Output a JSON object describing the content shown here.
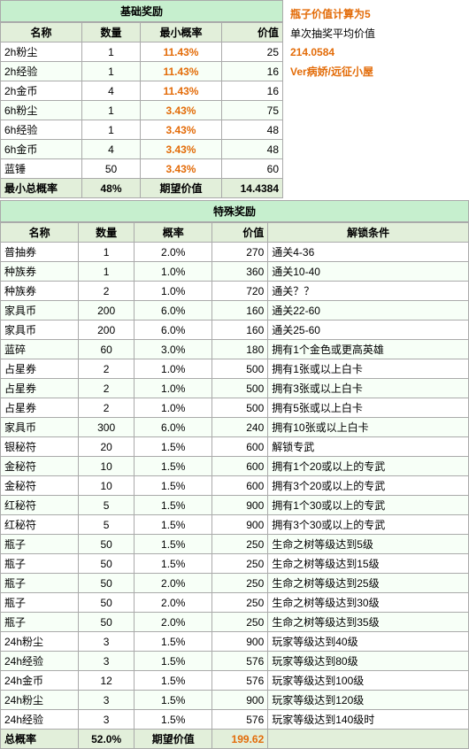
{
  "basic_section": {
    "header": "基础奖励",
    "columns": [
      "名称",
      "数量",
      "最小概率",
      "价值"
    ],
    "rows": [
      {
        "name": "2h粉尘",
        "count": "1",
        "prob": "11.43%",
        "value": "25"
      },
      {
        "name": "2h经验",
        "count": "1",
        "prob": "11.43%",
        "value": "16"
      },
      {
        "name": "2h金币",
        "count": "4",
        "prob": "11.43%",
        "value": "16"
      },
      {
        "name": "6h粉尘",
        "count": "1",
        "prob": "3.43%",
        "value": "75"
      },
      {
        "name": "6h经验",
        "count": "1",
        "prob": "3.43%",
        "value": "48"
      },
      {
        "name": "6h金币",
        "count": "4",
        "prob": "3.43%",
        "value": "48"
      },
      {
        "name": "蓝锤",
        "count": "50",
        "prob": "3.43%",
        "value": "60"
      }
    ],
    "footer": {
      "min_rate_label": "最小总概率",
      "min_rate_value": "48%",
      "expected_label": "期望价值",
      "expected_value": "14.4384"
    }
  },
  "side_info": {
    "line1": "瓶子价值计算为5",
    "line2": "单次抽奖平均价值",
    "line3": "214.0584",
    "line4": "Ver病娇/远征小屋"
  },
  "special_section": {
    "header": "特殊奖励",
    "columns": [
      "名称",
      "数量",
      "概率",
      "价值",
      "解锁条件"
    ],
    "rows": [
      {
        "name": "普抽券",
        "count": "1",
        "prob": "2.0%",
        "value": "270",
        "unlock": "通关4-36"
      },
      {
        "name": "种族券",
        "count": "1",
        "prob": "1.0%",
        "value": "360",
        "unlock": "通关10-40"
      },
      {
        "name": "种族券",
        "count": "2",
        "prob": "1.0%",
        "value": "720",
        "unlock": "通关？？"
      },
      {
        "name": "家具币",
        "count": "200",
        "prob": "6.0%",
        "value": "160",
        "unlock": "通关22-60"
      },
      {
        "name": "家具币",
        "count": "200",
        "prob": "6.0%",
        "value": "160",
        "unlock": "通关25-60"
      },
      {
        "name": "蓝碎",
        "count": "60",
        "prob": "3.0%",
        "value": "180",
        "unlock": "拥有1个金色或更高英雄"
      },
      {
        "name": "占星券",
        "count": "2",
        "prob": "1.0%",
        "value": "500",
        "unlock": "拥有1张或以上白卡"
      },
      {
        "name": "占星券",
        "count": "2",
        "prob": "1.0%",
        "value": "500",
        "unlock": "拥有3张或以上白卡"
      },
      {
        "name": "占星券",
        "count": "2",
        "prob": "1.0%",
        "value": "500",
        "unlock": "拥有5张或以上白卡"
      },
      {
        "name": "家具币",
        "count": "300",
        "prob": "6.0%",
        "value": "240",
        "unlock": "拥有10张或以上白卡"
      },
      {
        "name": "银秘符",
        "count": "20",
        "prob": "1.5%",
        "value": "600",
        "unlock": "解锁专武"
      },
      {
        "name": "金秘符",
        "count": "10",
        "prob": "1.5%",
        "value": "600",
        "unlock": "拥有1个20或以上的专武"
      },
      {
        "name": "金秘符",
        "count": "10",
        "prob": "1.5%",
        "value": "600",
        "unlock": "拥有3个20或以上的专武"
      },
      {
        "name": "红秘符",
        "count": "5",
        "prob": "1.5%",
        "value": "900",
        "unlock": "拥有1个30或以上的专武"
      },
      {
        "name": "红秘符",
        "count": "5",
        "prob": "1.5%",
        "value": "900",
        "unlock": "拥有3个30或以上的专武"
      },
      {
        "name": "瓶子",
        "count": "50",
        "prob": "1.5%",
        "value": "250",
        "unlock": "生命之树等级达到5级"
      },
      {
        "name": "瓶子",
        "count": "50",
        "prob": "1.5%",
        "value": "250",
        "unlock": "生命之树等级达到15级"
      },
      {
        "name": "瓶子",
        "count": "50",
        "prob": "2.0%",
        "value": "250",
        "unlock": "生命之树等级达到25级"
      },
      {
        "name": "瓶子",
        "count": "50",
        "prob": "2.0%",
        "value": "250",
        "unlock": "生命之树等级达到30级"
      },
      {
        "name": "瓶子",
        "count": "50",
        "prob": "2.0%",
        "value": "250",
        "unlock": "生命之树等级达到35级"
      },
      {
        "name": "24h粉尘",
        "count": "3",
        "prob": "1.5%",
        "value": "900",
        "unlock": "玩家等级达到40级"
      },
      {
        "name": "24h经验",
        "count": "3",
        "prob": "1.5%",
        "value": "576",
        "unlock": "玩家等级达到80级"
      },
      {
        "name": "24h金币",
        "count": "12",
        "prob": "1.5%",
        "value": "576",
        "unlock": "玩家等级达到100级"
      },
      {
        "name": "24h粉尘",
        "count": "3",
        "prob": "1.5%",
        "value": "900",
        "unlock": "玩家等级达到120级"
      },
      {
        "name": "24h经验",
        "count": "3",
        "prob": "1.5%",
        "value": "576",
        "unlock": "玩家等级达到140级时"
      }
    ],
    "footer": {
      "total_rate_label": "总概率",
      "total_rate_value": "52.0%",
      "expected_label": "期望价值",
      "expected_value": "199.62"
    }
  }
}
